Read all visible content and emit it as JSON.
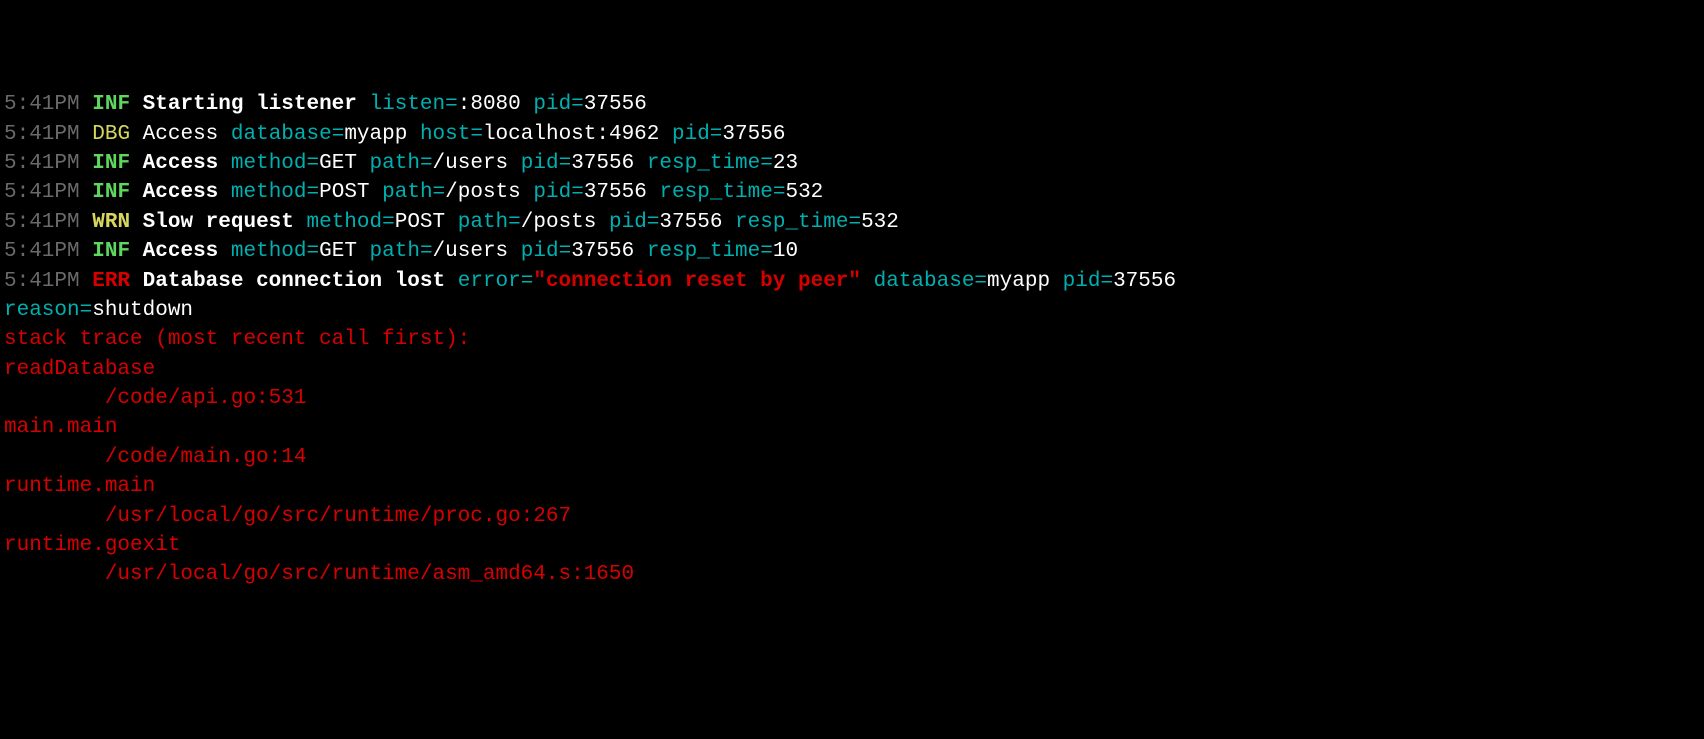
{
  "lines": [
    {
      "ts": "5:41PM",
      "level": "INF",
      "msg": "Starting listener",
      "fields": [
        {
          "k": "listen",
          "v": ":8080"
        },
        {
          "k": "pid",
          "v": "37556"
        }
      ]
    },
    {
      "ts": "5:41PM",
      "level": "DBG",
      "msg": "Access",
      "msgPlain": true,
      "fields": [
        {
          "k": "database",
          "v": "myapp"
        },
        {
          "k": "host",
          "v": "localhost:4962"
        },
        {
          "k": "pid",
          "v": "37556"
        }
      ]
    },
    {
      "ts": "5:41PM",
      "level": "INF",
      "msg": "Access",
      "fields": [
        {
          "k": "method",
          "v": "GET"
        },
        {
          "k": "path",
          "v": "/users"
        },
        {
          "k": "pid",
          "v": "37556"
        },
        {
          "k": "resp_time",
          "v": "23"
        }
      ]
    },
    {
      "ts": "5:41PM",
      "level": "INF",
      "msg": "Access",
      "fields": [
        {
          "k": "method",
          "v": "POST"
        },
        {
          "k": "path",
          "v": "/posts"
        },
        {
          "k": "pid",
          "v": "37556"
        },
        {
          "k": "resp_time",
          "v": "532"
        }
      ]
    },
    {
      "ts": "5:41PM",
      "level": "WRN",
      "msg": "Slow request",
      "fields": [
        {
          "k": "method",
          "v": "POST"
        },
        {
          "k": "path",
          "v": "/posts"
        },
        {
          "k": "pid",
          "v": "37556"
        },
        {
          "k": "resp_time",
          "v": "532"
        }
      ]
    },
    {
      "ts": "5:41PM",
      "level": "INF",
      "msg": "Access",
      "fields": [
        {
          "k": "method",
          "v": "GET"
        },
        {
          "k": "path",
          "v": "/users"
        },
        {
          "k": "pid",
          "v": "37556"
        },
        {
          "k": "resp_time",
          "v": "10"
        }
      ]
    },
    {
      "ts": "5:41PM",
      "level": "ERR",
      "msg": "Database connection lost",
      "fields": [
        {
          "k": "error",
          "v": "\"connection reset by peer\"",
          "err": true
        },
        {
          "k": "database",
          "v": "myapp"
        },
        {
          "k": "pid",
          "v": "37556"
        }
      ]
    }
  ],
  "wrap": {
    "fields": [
      {
        "k": "reason",
        "v": "shutdown"
      }
    ]
  },
  "trace_header": "stack trace (most recent call first):",
  "trace": [
    {
      "fn": "readDatabase",
      "loc": "        /code/api.go:531"
    },
    {
      "fn": "main.main",
      "loc": "        /code/main.go:14"
    },
    {
      "fn": "runtime.main",
      "loc": "        /usr/local/go/src/runtime/proc.go:267"
    },
    {
      "fn": "runtime.goexit",
      "loc": "        /usr/local/go/src/runtime/asm_amd64.s:1650"
    }
  ]
}
